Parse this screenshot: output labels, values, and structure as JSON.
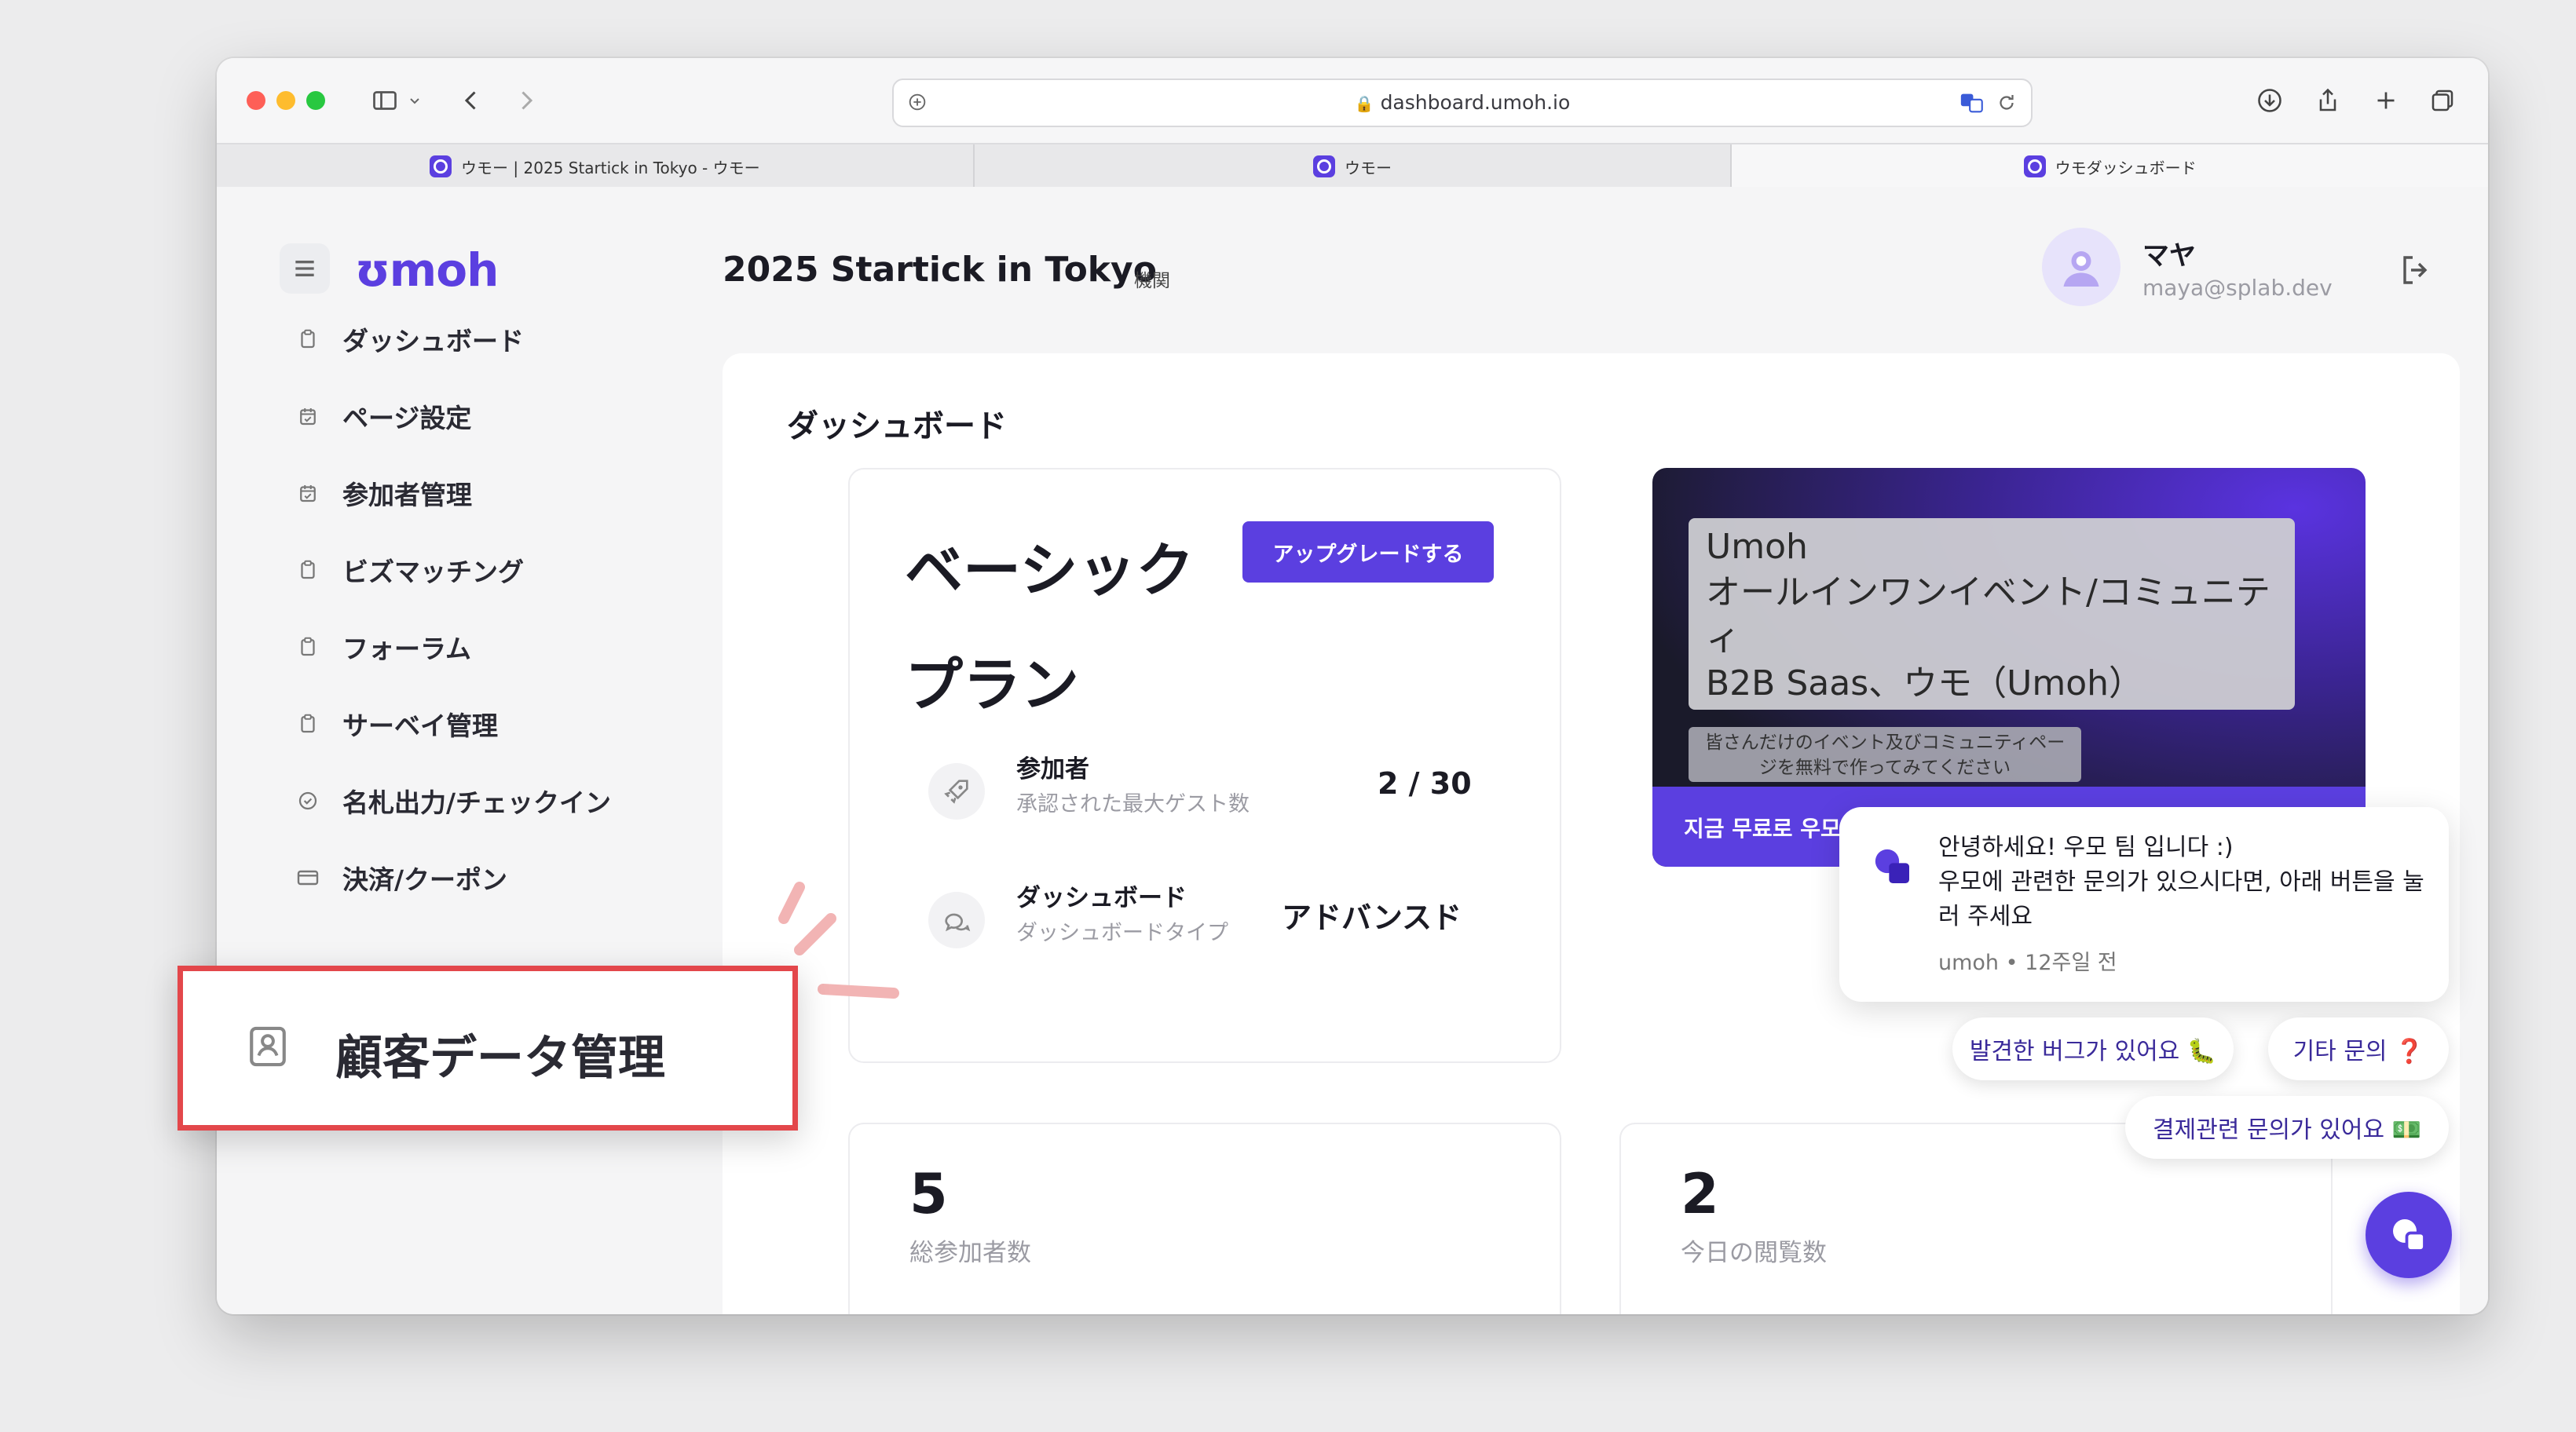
{
  "browser": {
    "url": "dashboard.umoh.io",
    "tabs": [
      {
        "label": "ウモー | 2025 Startick in Tokyo - ウモー"
      },
      {
        "label": "ウモー"
      },
      {
        "label": "ウモダッシュボード"
      }
    ]
  },
  "header": {
    "logo": "ʊmoh",
    "page_title": "2025 Startick in Tokyo",
    "org_tag": "機関",
    "user_name": "マヤ",
    "user_email": "maya@splab.dev"
  },
  "sidebar": {
    "items": [
      {
        "label": "ダッシュボード",
        "icon": "clipboard-icon"
      },
      {
        "label": "ページ設定",
        "icon": "calendar-check-icon",
        "expandable": true
      },
      {
        "label": "参加者管理",
        "icon": "calendar-check-icon",
        "expandable": true
      },
      {
        "label": "ビズマッチング",
        "icon": "clipboard-icon"
      },
      {
        "label": "フォーラム",
        "icon": "clipboard-icon"
      },
      {
        "label": "サーベイ管理",
        "icon": "clipboard-icon",
        "expandable": true
      },
      {
        "label": "名札出力/チェックイン",
        "icon": "check-circle-icon"
      },
      {
        "label": "決済/クーポン",
        "icon": "credit-card-icon"
      }
    ]
  },
  "callout": {
    "label": "顧客データ管理",
    "icon": "contact-card-icon"
  },
  "dashboard": {
    "section_title": "ダッシュボード",
    "plan": {
      "title": "ベーシックプラン",
      "upgrade_label": "アップグレードする",
      "participants_label": "参加者",
      "participants_sub": "承認された最大ゲスト数",
      "participants_value": "2 / 30",
      "dashboard_label": "ダッシュボード",
      "dashboard_sub": "ダッシュボードタイプ",
      "dashboard_value": "アドバンスド"
    },
    "stats": [
      {
        "value": "5",
        "label": "総参加者数"
      },
      {
        "value": "2",
        "label": "今日の閲覧数"
      }
    ]
  },
  "promo": {
    "title_line1": "Umoh",
    "title_line2": "オールインワンイベント/コミュニティ",
    "title_line3": "B2B Saas、ウモ（Umoh）",
    "tag_line1": "皆さんだけのイベント及びコミュニティペー",
    "tag_line2": "ジを無料で作ってみてください",
    "cta": "지금 무료로 우모(Um"
  },
  "chat": {
    "greeting": "안녕하세요! 우모 팀 입니다 :)",
    "message": "우모에 관련한 문의가 있으시다면, 아래 버튼을 눌러 주세요",
    "meta": "umoh • 12주일 전",
    "chips": [
      {
        "label": "발견한 버그가 있어요 🐛"
      },
      {
        "label": "기타 문의 ❓"
      },
      {
        "label": "결제관련 문의가 있어요 💵"
      }
    ]
  },
  "colors": {
    "brand": "#5b3fe0",
    "callout_border": "#e3474b"
  }
}
